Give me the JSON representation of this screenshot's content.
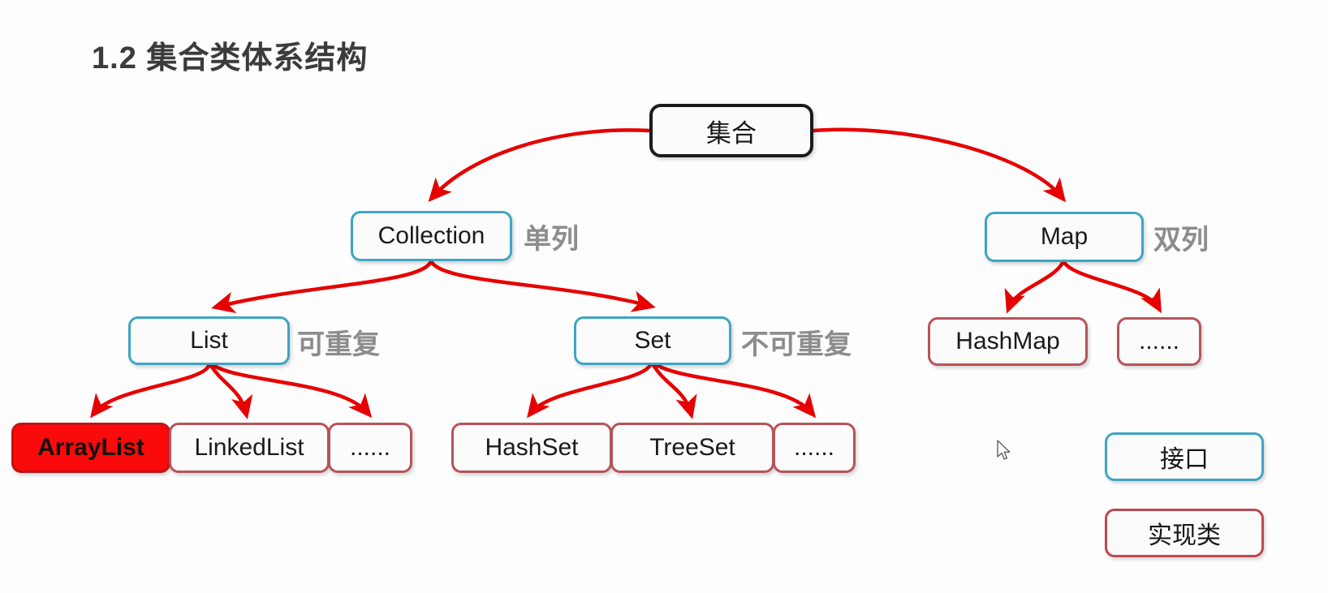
{
  "title": "1.2 集合类体系结构",
  "diagram": {
    "type": "hierarchy-tree",
    "root": {
      "label": "集合",
      "kind": "root"
    },
    "level1": [
      {
        "label": "Collection",
        "kind": "interface",
        "annotation": "单列"
      },
      {
        "label": "Map",
        "kind": "interface",
        "annotation": "双列"
      }
    ],
    "level2": [
      {
        "label": "List",
        "kind": "interface",
        "annotation": "可重复",
        "parent": "Collection"
      },
      {
        "label": "Set",
        "kind": "interface",
        "annotation": "不可重复",
        "parent": "Collection"
      },
      {
        "label": "HashMap",
        "kind": "implementation",
        "parent": "Map"
      },
      {
        "label": "......",
        "kind": "implementation",
        "parent": "Map"
      }
    ],
    "level3": [
      {
        "label": "ArrayList",
        "kind": "implementation",
        "highlighted": true,
        "parent": "List"
      },
      {
        "label": "LinkedList",
        "kind": "implementation",
        "highlighted": false,
        "parent": "List"
      },
      {
        "label": "......",
        "kind": "implementation",
        "highlighted": false,
        "parent": "List"
      },
      {
        "label": "HashSet",
        "kind": "implementation",
        "highlighted": false,
        "parent": "Set"
      },
      {
        "label": "TreeSet",
        "kind": "implementation",
        "highlighted": false,
        "parent": "Set"
      },
      {
        "label": "......",
        "kind": "implementation",
        "highlighted": false,
        "parent": "Set"
      }
    ]
  },
  "annotations": {
    "collection_note": "单列",
    "map_note": "双列",
    "list_note": "可重复",
    "set_note": "不可重复"
  },
  "legend": [
    {
      "label": "接口",
      "kind": "interface"
    },
    {
      "label": "实现类",
      "kind": "implementation"
    }
  ],
  "colors": {
    "interface_border": "#3ea5c4",
    "implementation_border": "#b5545a",
    "highlight_fill": "#fa0a0a",
    "highlight_border": "#c31216",
    "root_border": "#1b1b1b",
    "arrow": "#e60000",
    "annotation_text": "#8d8d8d",
    "title_text": "#3b3b3b",
    "background": "#fdfdfd"
  }
}
